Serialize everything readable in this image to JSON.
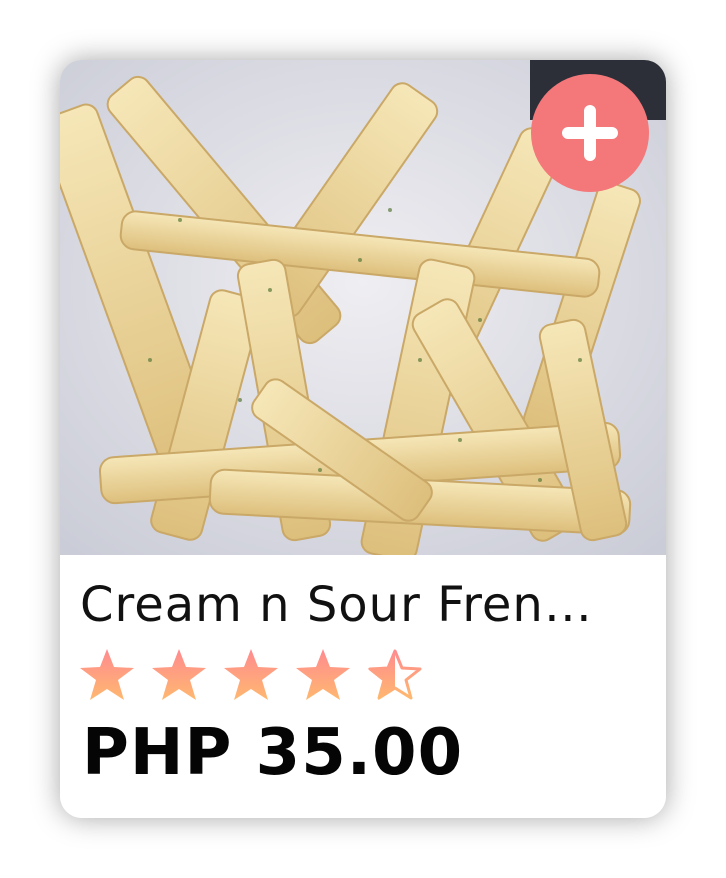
{
  "product": {
    "name": "Cream n Sour French Fries",
    "name_display": "Cream n Sour Fren…",
    "price": "PHP 35.00",
    "rating": 4.5,
    "rating_max": 5,
    "image_description_icon": "french-fries-photo"
  },
  "actions": {
    "add_icon": "plus-icon"
  },
  "colors": {
    "accent": "#f4777a",
    "star_top": "#ff8a8f",
    "star_bottom": "#ffb870",
    "price_text": "#050505"
  }
}
